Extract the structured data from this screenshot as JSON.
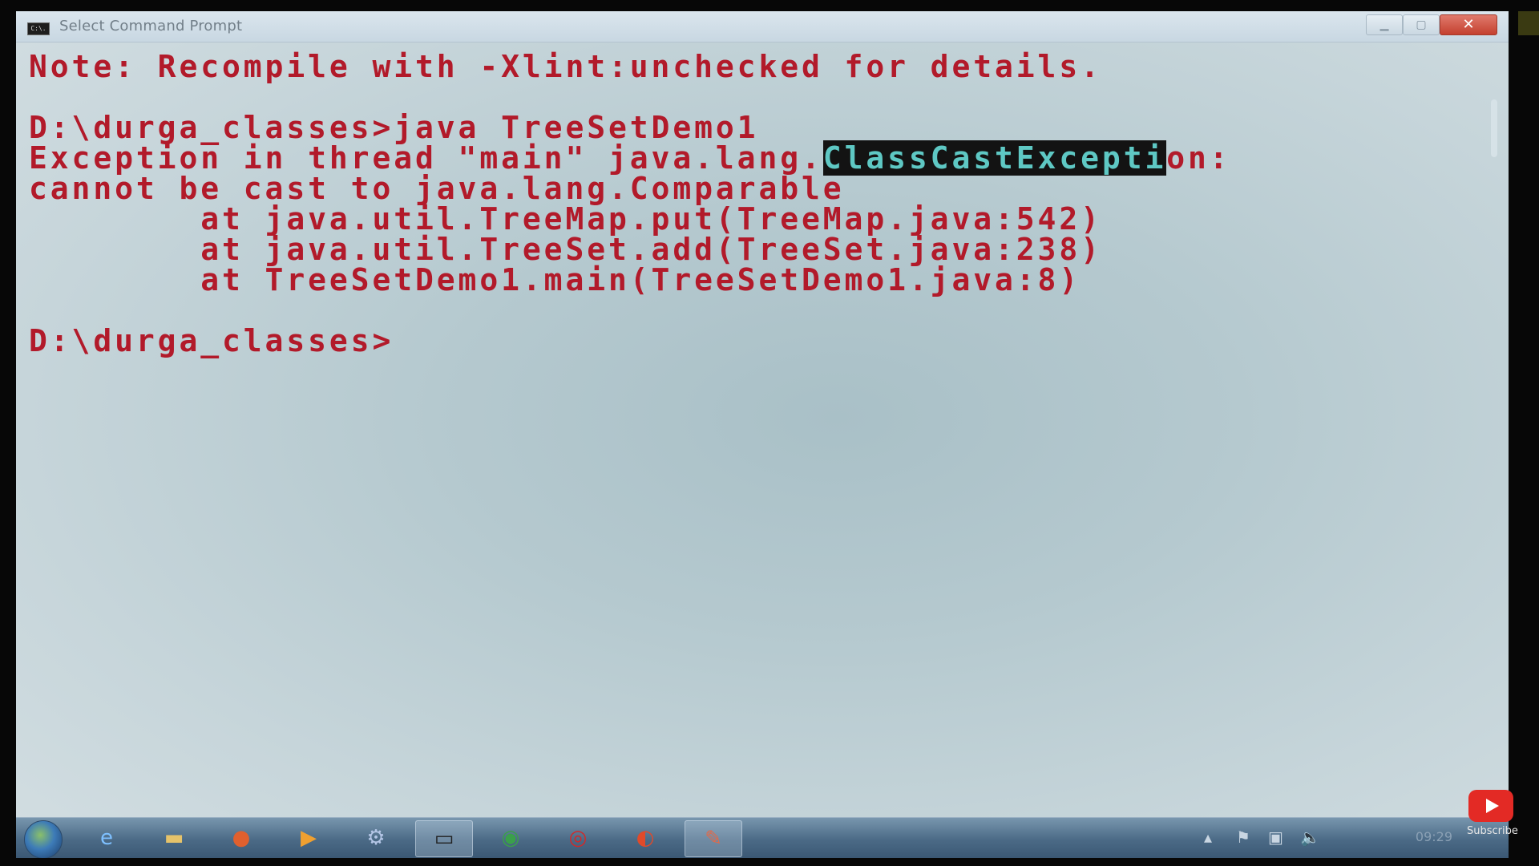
{
  "window": {
    "title": "Select Command Prompt",
    "icon_text": "C:\\.",
    "minimize_icon": "minimize-icon",
    "maximize_icon": "maximize-icon",
    "close_symbol": "✕"
  },
  "console": {
    "lines": [
      {
        "text": "Note: Recompile with -Xlint:unchecked for details."
      },
      {
        "text": ""
      },
      {
        "text": "D:\\durga_classes>java TreeSetDemo1"
      },
      {
        "pre": "Exception in thread \"main\" java.lang.",
        "highlight": "ClassCastExcepti",
        "post": "on:"
      },
      {
        "text": "cannot be cast to java.lang.Comparable"
      },
      {
        "text": "        at java.util.TreeMap.put(TreeMap.java:542)"
      },
      {
        "text": "        at java.util.TreeSet.add(TreeSet.java:238)"
      },
      {
        "text": "        at TreeSetDemo1.main(TreeSetDemo1.java:8)"
      },
      {
        "text": ""
      },
      {
        "text": "D:\\durga_classes>"
      }
    ],
    "text_color": "#b21a2a",
    "highlight_color": "#5ec8c4"
  },
  "taskbar": {
    "items": [
      {
        "icon": "ie-icon",
        "glyph": "e",
        "color": "#7ec0ff"
      },
      {
        "icon": "folder-icon",
        "glyph": "▬",
        "color": "#e6c36a"
      },
      {
        "icon": "firefox-icon",
        "glyph": "●",
        "color": "#e0602e"
      },
      {
        "icon": "media-player-icon",
        "glyph": "▶",
        "color": "#f0a030"
      },
      {
        "icon": "network-icon",
        "glyph": "⚙",
        "color": "#b4c6e6"
      },
      {
        "icon": "command-prompt-icon",
        "glyph": "▭",
        "color": "#202020",
        "active": true
      },
      {
        "icon": "chrome-icon",
        "glyph": "◉",
        "color": "#3aa04a"
      },
      {
        "icon": "opera-icon",
        "glyph": "◎",
        "color": "#d02a2a"
      },
      {
        "icon": "app-icon",
        "glyph": "◐",
        "color": "#e04a2a"
      },
      {
        "icon": "paint-icon",
        "glyph": "✎",
        "color": "#e06a4a",
        "active": true
      }
    ],
    "clock": "09:29"
  },
  "overlay": {
    "subscribe_label": "Subscribe"
  }
}
